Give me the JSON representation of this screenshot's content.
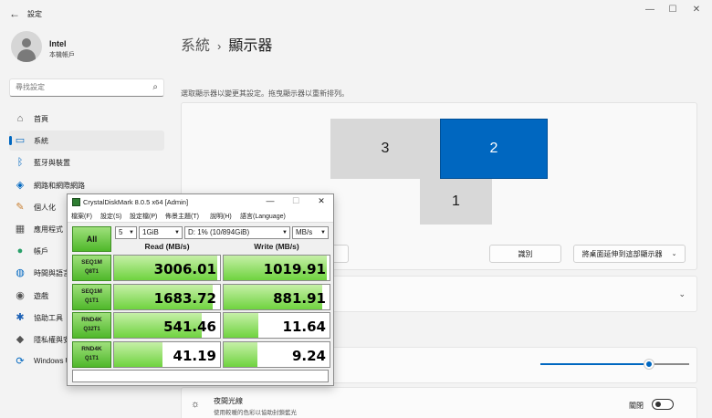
{
  "window": {
    "app_title": "設定",
    "controls": {
      "minimize": "—",
      "maximize": "☐",
      "close": "✕"
    }
  },
  "user": {
    "name": "Intel",
    "subtitle": "本機帳戶"
  },
  "search": {
    "placeholder": "尋找設定"
  },
  "sidebar": {
    "items": [
      {
        "label": "首頁",
        "icon": "home-icon",
        "glyph": "⌂"
      },
      {
        "label": "系統",
        "icon": "system-icon",
        "glyph": "▭",
        "active": true
      },
      {
        "label": "藍牙與裝置",
        "icon": "bluetooth-icon",
        "glyph": "ᛒ"
      },
      {
        "label": "網路和網際網路",
        "icon": "wifi-icon",
        "glyph": "◈"
      },
      {
        "label": "個人化",
        "icon": "brush-icon",
        "glyph": "✎"
      },
      {
        "label": "應用程式",
        "icon": "apps-icon",
        "glyph": "▦"
      },
      {
        "label": "帳戶",
        "icon": "account-icon",
        "glyph": "●"
      },
      {
        "label": "時間與語言",
        "icon": "globe-icon",
        "glyph": "◍"
      },
      {
        "label": "遊戲",
        "icon": "gamepad-icon",
        "glyph": "◉"
      },
      {
        "label": "協助工具",
        "icon": "accessibility-icon",
        "glyph": "✱"
      },
      {
        "label": "隱私權與安全性",
        "icon": "shield-icon",
        "glyph": "◆"
      },
      {
        "label": "Windows Update",
        "icon": "update-icon",
        "glyph": "⟳"
      }
    ]
  },
  "main": {
    "breadcrumb_parent": "系統",
    "breadcrumb_sep": "›",
    "breadcrumb_current": "顯示器",
    "hint": "選取顯示器以變更其設定。拖曳顯示器以重新排列。",
    "monitors": [
      {
        "label": "3",
        "selected": false
      },
      {
        "label": "2",
        "selected": true
      },
      {
        "label": "1",
        "selected": false
      }
    ],
    "identify_button": "識別",
    "extend_dropdown": "將桌面延伸到這部顯示器",
    "night_light": {
      "title": "夜間光線",
      "subtitle": "使用較暖的色彩以協助封鎖藍光",
      "state": "關閉"
    },
    "brightness_level": 0.73
  },
  "cdm": {
    "title": "CrystalDiskMark 8.0.5 x64 [Admin]",
    "menu": [
      "檔案(F)",
      "設定(S)",
      "設定檔(P)",
      "佈景主題(T)",
      "說明(H)",
      "語言(Language)"
    ],
    "all_label": "All",
    "count": "5",
    "size": "1GiB",
    "drive": "D: 1% (10/894GiB)",
    "unit": "MB/s",
    "read_header": "Read (MB/s)",
    "write_header": "Write (MB/s)",
    "rows": [
      {
        "l1": "SEQ1M",
        "l2": "Q8T1",
        "read": "3006.01",
        "write": "1019.91",
        "read_fill": 0.97,
        "write_fill": 0.97
      },
      {
        "l1": "SEQ1M",
        "l2": "Q1T1",
        "read": "1683.72",
        "write": "881.91",
        "read_fill": 0.93,
        "write_fill": 0.93
      },
      {
        "l1": "RND4K",
        "l2": "Q32T1",
        "read": "541.46",
        "write": "11.64",
        "read_fill": 0.83,
        "write_fill": 0.33
      },
      {
        "l1": "RND4K",
        "l2": "Q1T1",
        "read": "41.19",
        "write": "9.24",
        "read_fill": 0.46,
        "write_fill": 0.32
      }
    ],
    "comment": ""
  }
}
